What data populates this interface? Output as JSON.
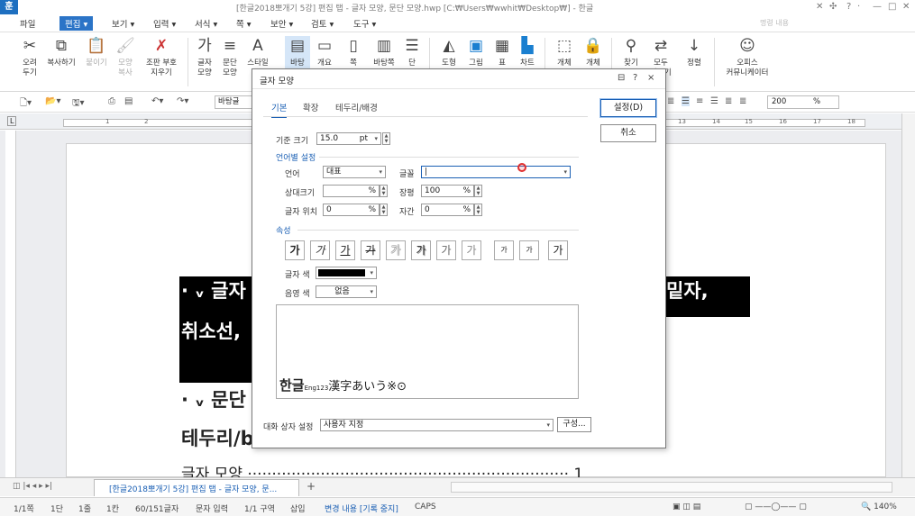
{
  "app": {
    "icon_glyph": "훈",
    "title": "[한글2018뽀개기 5강] 편집 탭 - 글자 모양, 문단 모양.hwp [C:₩Users₩wwhit₩Desktop₩] - 한글",
    "help_search_placeholder": "명령 내용"
  },
  "menubar": {
    "file": "파일",
    "edit": "편집",
    "view": "보기",
    "insert": "입력",
    "format": "서식",
    "page": "쪽",
    "security": "보안",
    "review": "검토",
    "tools": "도구",
    "dropdown_glyph": "▾"
  },
  "ribbon": {
    "cut": "오려\n두기",
    "copy": "복사하기",
    "paste": "붙이기",
    "format_copy": "모양\n복사",
    "symbol_delete": "조판 부호\n지우기",
    "char_shape": "글자\n모양",
    "para_shape": "문단\n모양",
    "style": "스타일",
    "b1": "바탕",
    "b2": "개요",
    "b3": "쪽",
    "b4": "바탕쪽",
    "b5": "단",
    "b6": "도형",
    "b7": "그림",
    "b8": "표",
    "b9": "차트",
    "b10": "개체",
    "b11": "개체",
    "find": "찾기",
    "replace": "모두\n바꾸기",
    "sort": "정렬",
    "office": "오피스\n커뮤니케이터"
  },
  "toolbar2": {
    "style_value": "바탕글",
    "zoom_value": "200",
    "zoom_unit": "%"
  },
  "ruler": {
    "numbers": [
      "1",
      "2",
      "13",
      "14",
      "15",
      "16",
      "17",
      "18"
    ]
  },
  "document": {
    "line1": "· ᵥ 글자",
    "line1_right": "밑자,",
    "line2": "취소선,",
    "line3": "· ᵥ 문단",
    "line4": "테두리/b",
    "line5": "글자 모양 ·································································· 1"
  },
  "doc_tab": {
    "label": "[한글2018뽀개기 5강] 편집 탭 - 글자 모양, 문...",
    "add": "+"
  },
  "statusbar": {
    "page": "1/1쪽",
    "section": "1단",
    "line": "1줄",
    "column": "1칸",
    "chars": "60/151글자",
    "mode": "문자 입력",
    "zone": "1/1 구역",
    "insert": "삽입",
    "track": "변경 내용 [기록 중지]",
    "caps": "CAPS",
    "zoom": "140%"
  },
  "dialog": {
    "title": "글자 모양",
    "tabs": [
      "기본",
      "확장",
      "테두리/배경"
    ],
    "base_size_label": "기준 크기",
    "base_size_value": "15.0",
    "base_size_unit": "pt",
    "lang_section": "언어별 설정",
    "lang_label": "언어",
    "lang_value": "대표",
    "font_label": "글꼴",
    "font_value": "",
    "rel_size_label": "상대크기",
    "rel_size_value": "",
    "ratio_label": "장평",
    "ratio_value": "100",
    "pos_label": "글자 위치",
    "pos_value": "0",
    "spacing_label": "자간",
    "spacing_value": "0",
    "percent": "%",
    "attr_section": "속성",
    "attr_buttons": [
      "가",
      "가",
      "가",
      "가",
      "가",
      "가",
      "가",
      "가",
      "가",
      "가",
      "가"
    ],
    "color_label": "글자 색",
    "shade_label": "음영 색",
    "shade_value": "없음",
    "preview_text_big": "한글",
    "preview_text_small": "Eng123",
    "preview_text_rest": "漢字あいう※⊙",
    "ok_button": "설정(D)",
    "cancel_button": "취소",
    "dialog_style_label": "대화 상자 설정",
    "dialog_style_value": "사용자 지정",
    "config_button": "구성...",
    "help_glyph": "?",
    "close_glyph": "×"
  },
  "colors": {
    "accent": "#2b74c7",
    "text_color_swatch": "#000000"
  }
}
